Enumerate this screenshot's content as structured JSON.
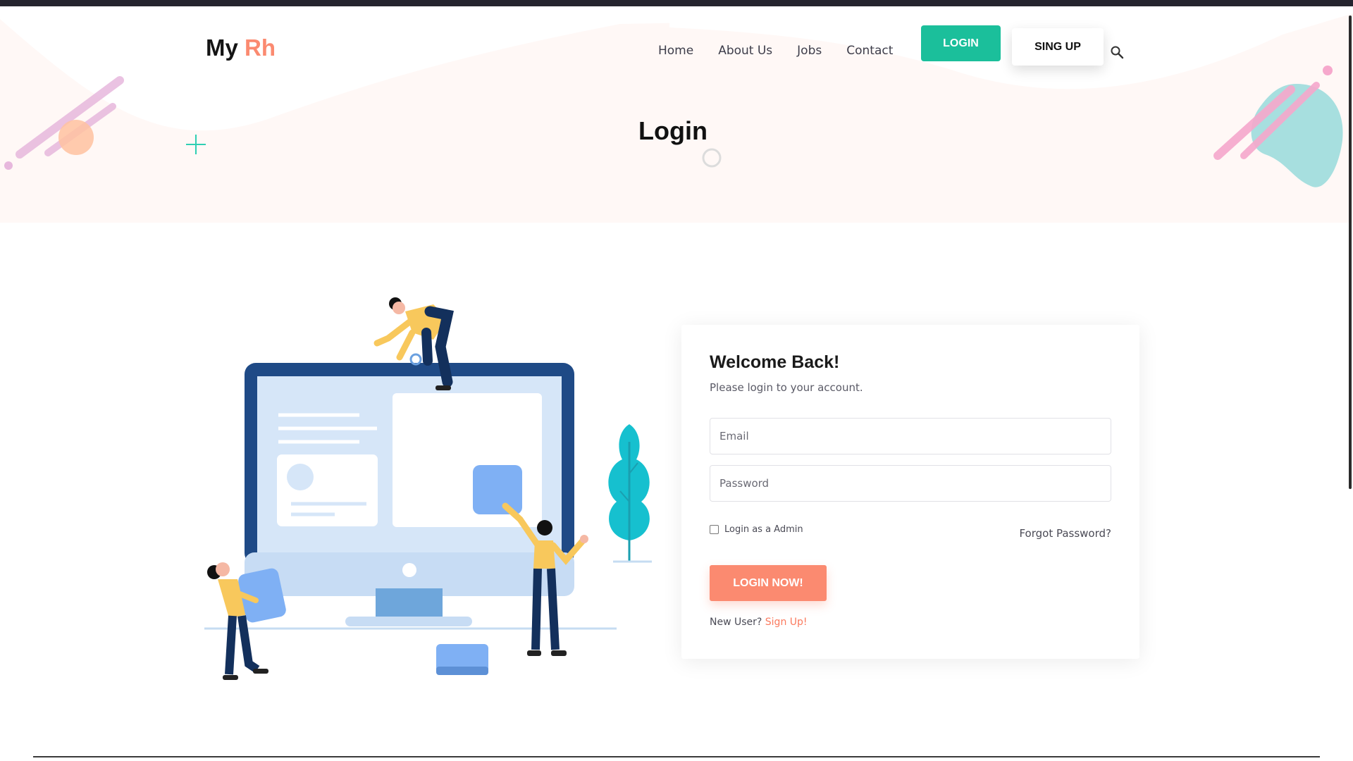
{
  "brand": {
    "prefix": "My",
    "suffix": "Rh",
    "accent_color": "#fb8a70"
  },
  "nav": {
    "items": [
      "Home",
      "About Us",
      "Jobs",
      "Contact"
    ]
  },
  "header_buttons": {
    "login": "LOGIN",
    "signup": "SING UP",
    "login_color": "#1bbf9b"
  },
  "icons": {
    "search": "search-icon"
  },
  "hero": {
    "title": "Login"
  },
  "login_card": {
    "heading": "Welcome Back!",
    "subtitle": "Please login to your account.",
    "email_placeholder": "Email",
    "password_placeholder": "Password",
    "admin_label": "Login as a Admin",
    "admin_checked": false,
    "forgot": "Forgot Password?",
    "submit": "LOGIN NOW!",
    "new_user": "New User?",
    "signup_link": "Sign Up!",
    "submit_color": "#fb8a70"
  }
}
